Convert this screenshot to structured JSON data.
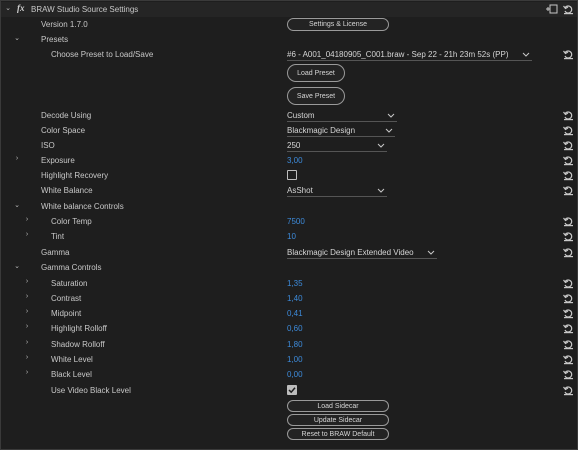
{
  "header": {
    "fx_label": "fx",
    "title": "BRAW Studio Source Settings"
  },
  "version": "Version 1.7.0",
  "settings_license_label": "Settings & License",
  "presets": {
    "section_label": "Presets",
    "choose_label": "Choose Preset to Load/Save",
    "selected": "#6 - A001_04180905_C001.braw - Sep 22 - 21h 23m 52s (PP)",
    "load_label": "Load Preset",
    "save_label": "Save Preset"
  },
  "decode": {
    "label": "Decode Using",
    "value": "Custom"
  },
  "color_space": {
    "label": "Color Space",
    "value": "Blackmagic Design"
  },
  "iso": {
    "label": "ISO",
    "value": "250"
  },
  "exposure": {
    "label": "Exposure",
    "value": "3,00"
  },
  "highlight_recovery": {
    "label": "Highlight Recovery",
    "checked": false
  },
  "white_balance": {
    "label": "White Balance",
    "value": "AsShot"
  },
  "wb_controls": {
    "section_label": "White balance Controls",
    "color_temp": {
      "label": "Color Temp",
      "value": "7500"
    },
    "tint": {
      "label": "Tint",
      "value": "10"
    }
  },
  "gamma": {
    "label": "Gamma",
    "value": "Blackmagic Design Extended Video"
  },
  "gamma_controls": {
    "section_label": "Gamma Controls",
    "saturation": {
      "label": "Saturation",
      "value": "1,35"
    },
    "contrast": {
      "label": "Contrast",
      "value": "1,40"
    },
    "midpoint": {
      "label": "Midpoint",
      "value": "0,41"
    },
    "highlight_rolloff": {
      "label": "Highlight Rolloff",
      "value": "0,60"
    },
    "shadow_rolloff": {
      "label": "Shadow Rolloff",
      "value": "1,80"
    },
    "white_level": {
      "label": "White Level",
      "value": "1,00"
    },
    "black_level": {
      "label": "Black Level",
      "value": "0,00"
    },
    "use_video_black_level": {
      "label": "Use Video Black Level",
      "checked": true
    }
  },
  "sidecar": {
    "load_label": "Load Sidecar",
    "update_label": "Update Sidecar",
    "reset_label": "Reset to BRAW Default"
  },
  "colors": {
    "value_blue": "#3d8bdb",
    "background": "#1e1e1e",
    "text": "#c8c8c8"
  }
}
